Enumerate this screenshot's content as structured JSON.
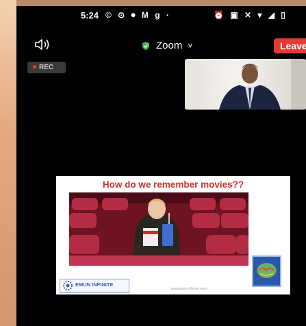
{
  "status_bar": {
    "time": "5:24",
    "left_icons": "© ⊙ ⏺ M g ·",
    "right_icons": "⏰ ▣ ✕ ▾ ◢ ▯"
  },
  "toolbar": {
    "speaker_icon": "speaker-icon",
    "app_title": "Zoom",
    "title_caret": "˅",
    "shield_icon": "shield-icon",
    "leave_label": "Leave"
  },
  "rec_badge": {
    "label": "REC"
  },
  "slide": {
    "title": "How do we remember movies??",
    "logo_text": "EMUN INFINITE",
    "url": "www.bon-infinite.com"
  },
  "colors": {
    "leave": "#e53935",
    "shield": "#4caf50",
    "slide_title": "#d03030",
    "rec_dot": "#ff3b30"
  }
}
